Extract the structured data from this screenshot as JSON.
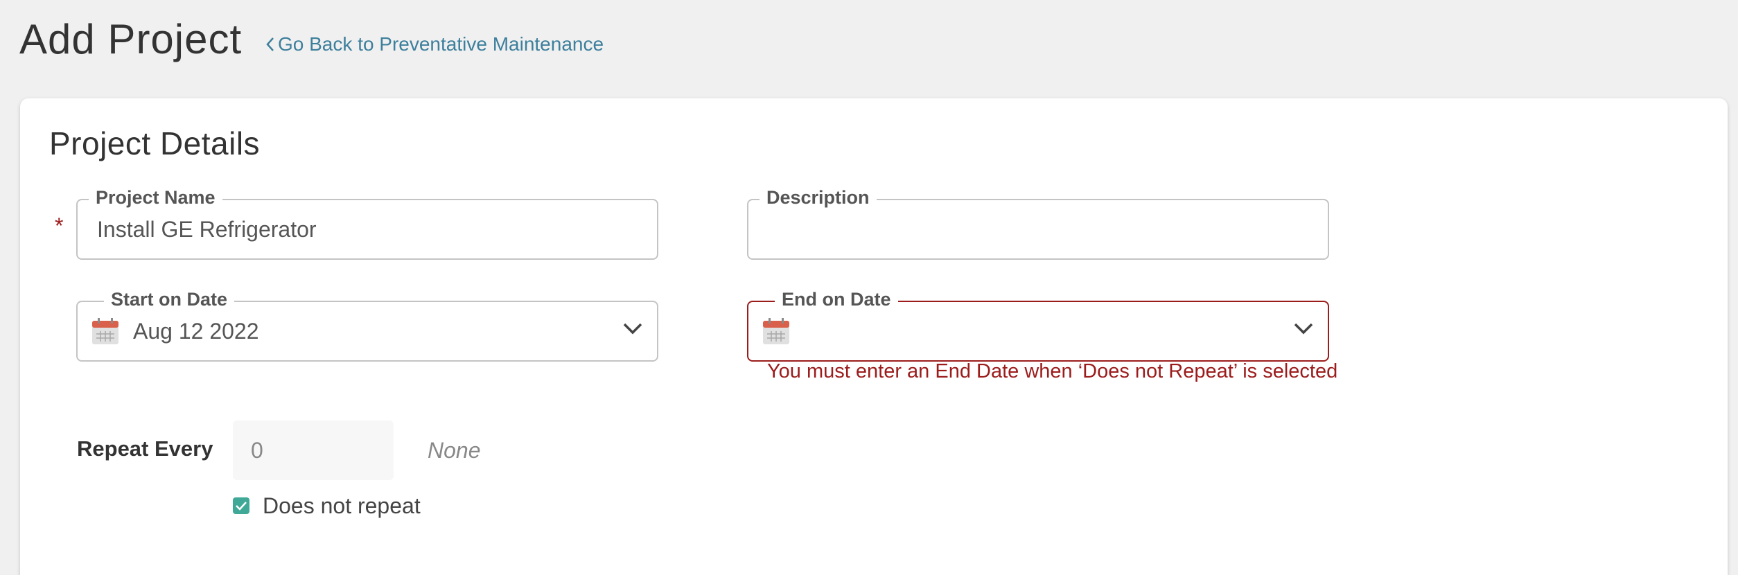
{
  "header": {
    "title": "Add Project",
    "back_link": "Go Back to Preventative Maintenance"
  },
  "section": {
    "title": "Project Details"
  },
  "form": {
    "project_name": {
      "label": "Project Name",
      "value": "Install GE Refrigerator",
      "required_marker": "*"
    },
    "description": {
      "label": "Description",
      "value": ""
    },
    "start_date": {
      "label": "Start on Date",
      "value": "Aug 12 2022"
    },
    "end_date": {
      "label": "End on Date",
      "value": "",
      "error": "You must enter an End Date when ‘Does not Repeat’ is selected"
    },
    "repeat": {
      "label": "Repeat Every",
      "value": "0",
      "unit": "None",
      "checkbox_label": "Does not repeat",
      "checked": true
    }
  },
  "colors": {
    "accent_link": "#3d7f9c",
    "error": "#9c1c1c",
    "checkbox": "#3fa896",
    "calendar_top": "#d9604a"
  }
}
